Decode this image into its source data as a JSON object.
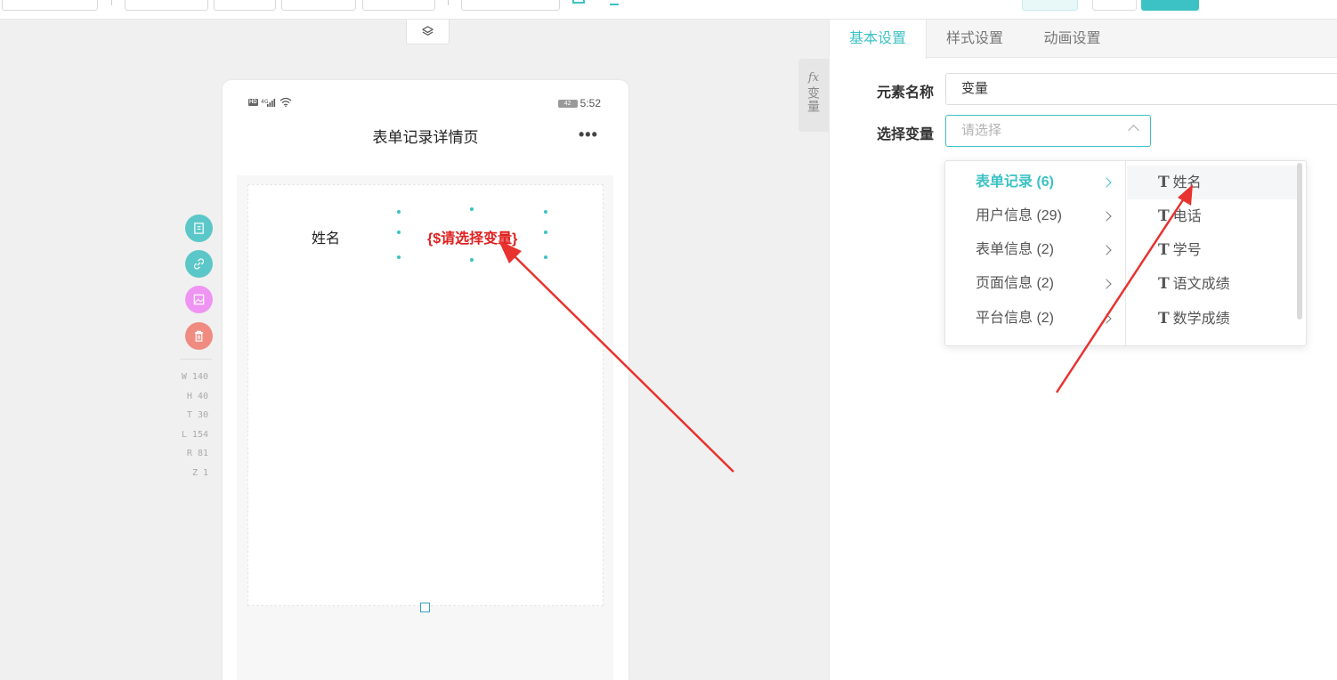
{
  "canvas": {
    "variable_tab": {
      "fx": "fx",
      "label": "变量"
    }
  },
  "phone": {
    "status_time": "5:52",
    "battery": "42",
    "title": "表单记录详情页",
    "more": "•••",
    "field_label": "姓名",
    "variable_placeholder": "{$请选择变量}"
  },
  "dimensions": [
    "W 140",
    "H 40",
    "T 30",
    "L 154",
    "R 81",
    "Z 1"
  ],
  "panel": {
    "tabs": [
      "基本设置",
      "样式设置",
      "动画设置"
    ],
    "active_tab": "基本设置",
    "element_name_label": "元素名称",
    "element_name_value": "变量",
    "select_var_label": "选择变量",
    "select_var_placeholder": "请选择"
  },
  "cascader": {
    "groups": [
      "表单记录 (6)",
      "用户信息 (29)",
      "表单信息 (2)",
      "页面信息 (2)",
      "平台信息 (2)"
    ],
    "active_group": "表单记录 (6)",
    "type_glyph": "T",
    "fields": [
      "姓名",
      "电话",
      "学号",
      "语文成绩",
      "数学成绩"
    ],
    "hovered_field": "姓名"
  },
  "colors": {
    "accent": "#3cc2c4",
    "variable_red": "#e0201f",
    "arrow_red": "#e8322e"
  }
}
